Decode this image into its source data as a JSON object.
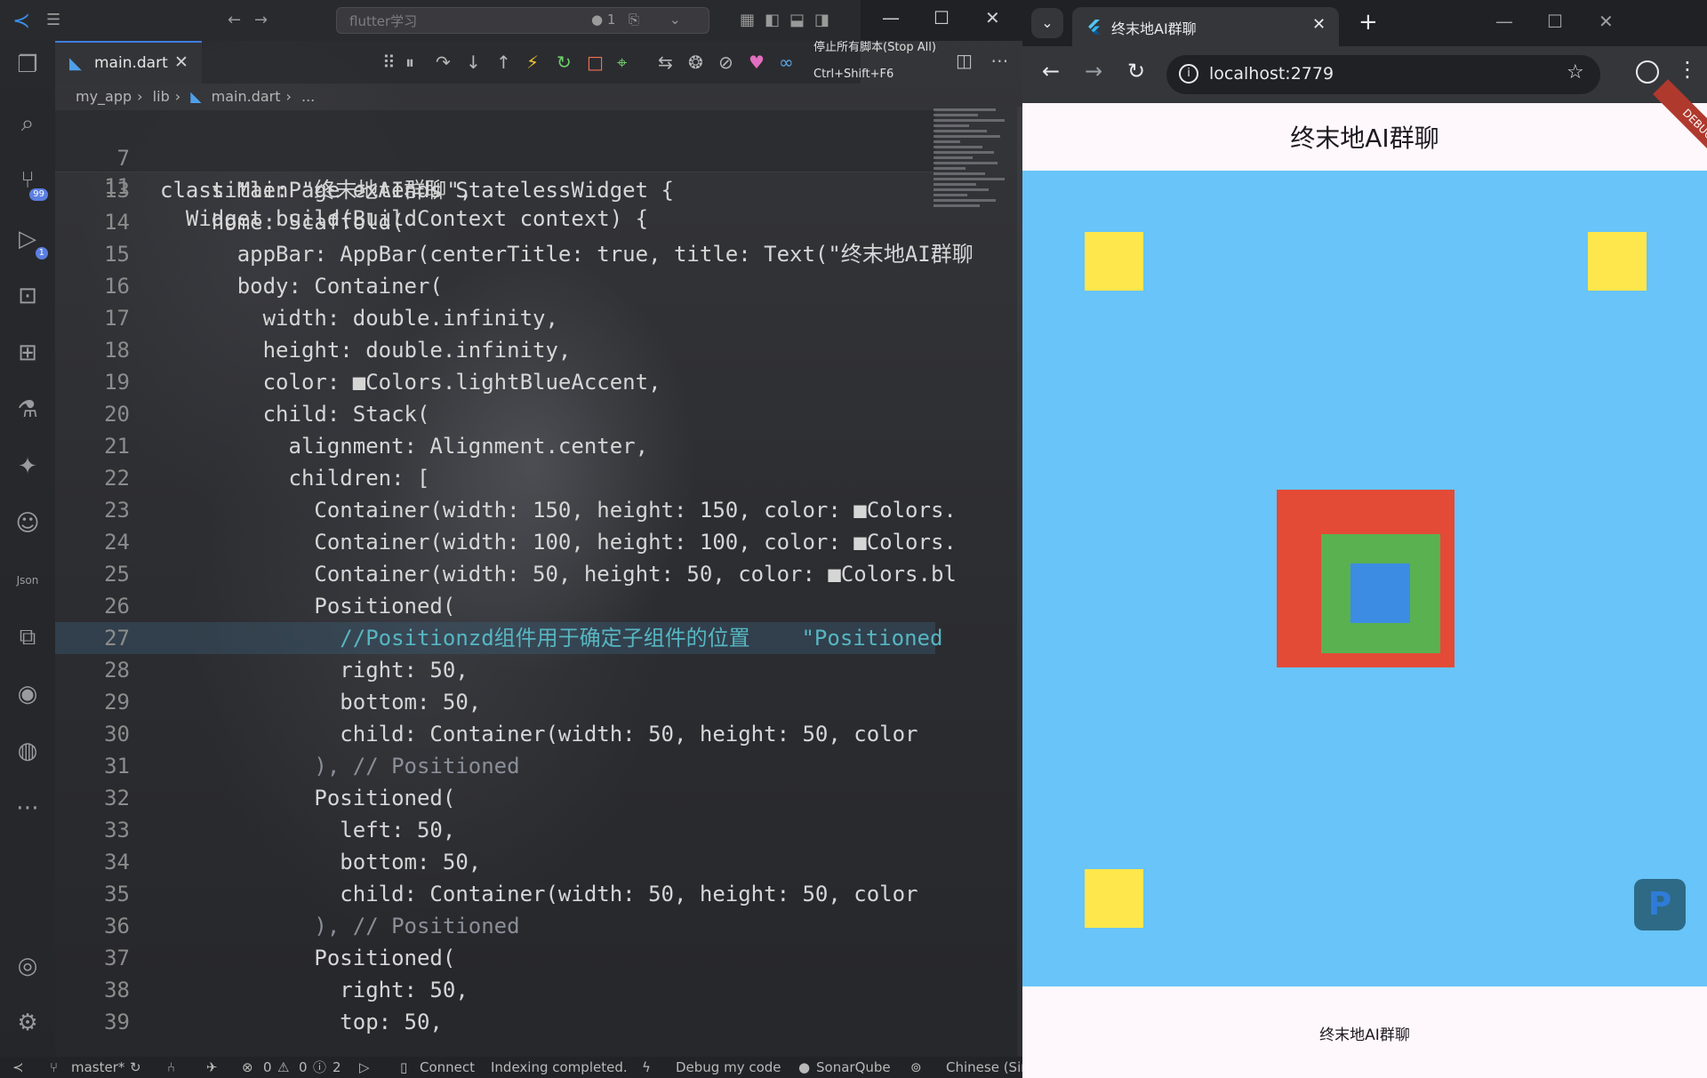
{
  "vscode": {
    "search_placeholder": "flutter学习",
    "tab": {
      "label": "main.dart"
    },
    "breadcrumb": [
      "my_app",
      "lib",
      "main.dart",
      "..."
    ],
    "stop_tooltip": {
      "label": "停止所有脚本(Stop All)",
      "shortcut": "Ctrl+Shift+F6"
    },
    "activity_badges": {
      "scm": "99",
      "debug": "1"
    },
    "activity_icons": [
      "explorer-icon",
      "search-icon",
      "source-control-icon",
      "run-debug-icon",
      "remote-explorer-icon",
      "extensions-icon",
      "testing-icon",
      "flutter-icon",
      "copilot-icon",
      "json-icon",
      "branch-graph-icon",
      "github-icon",
      "sync-icon",
      "more-icon",
      "account-icon",
      "settings-icon"
    ],
    "sticky_lines": [
      {
        "num": "7",
        "text": "class MainPage extends StatelessWidget {"
      },
      {
        "num": "11",
        "text": "  Widget build(BuildContext context) {"
      }
    ],
    "lines": [
      {
        "num": "13",
        "text": "    title: \"终末地AI群聊\","
      },
      {
        "num": "14",
        "text": "    home: Scaffold("
      },
      {
        "num": "15",
        "text": "      appBar: AppBar(centerTitle: true, title: Text(\"终末地AI群聊"
      },
      {
        "num": "16",
        "text": "      body: Container("
      },
      {
        "num": "17",
        "text": "        width: double.infinity,"
      },
      {
        "num": "18",
        "text": "        height: double.infinity,"
      },
      {
        "num": "19",
        "text": "        color: ■Colors.lightBlueAccent,"
      },
      {
        "num": "20",
        "text": "        child: Stack("
      },
      {
        "num": "21",
        "text": "          alignment: Alignment.center,"
      },
      {
        "num": "22",
        "text": "          children: ["
      },
      {
        "num": "23",
        "text": "            Container(width: 150, height: 150, color: ■Colors."
      },
      {
        "num": "24",
        "text": "            Container(width: 100, height: 100, color: ■Colors."
      },
      {
        "num": "25",
        "text": "            Container(width: 50, height: 50, color: ■Colors.bl"
      },
      {
        "num": "26",
        "text": "            Positioned("
      },
      {
        "num": "27",
        "text": "              //Positionzd组件用于确定子组件的位置    \"Positioned"
      },
      {
        "num": "28",
        "text": "              right: 50,"
      },
      {
        "num": "29",
        "text": "              bottom: 50,"
      },
      {
        "num": "30",
        "text": "              child: Container(width: 50, height: 50, color"
      },
      {
        "num": "31",
        "text": "            ), // Positioned"
      },
      {
        "num": "32",
        "text": "            Positioned("
      },
      {
        "num": "33",
        "text": "              left: 50,"
      },
      {
        "num": "34",
        "text": "              bottom: 50,"
      },
      {
        "num": "35",
        "text": "              child: Container(width: 50, height: 50, color"
      },
      {
        "num": "36",
        "text": "            ), // Positioned"
      },
      {
        "num": "37",
        "text": "            Positioned("
      },
      {
        "num": "38",
        "text": "              right: 50,"
      },
      {
        "num": "39",
        "text": "              top: 50,"
      }
    ],
    "swatches": {
      "lightBlueAccent": "#40c4ff",
      "red": "#f44336",
      "green": "#4caf50",
      "blue": "#64b5f6"
    },
    "status": {
      "branch": "master*",
      "problems": "0",
      "warnings": "0",
      "infos": "2",
      "connect": "Connect",
      "indexing": "Indexing completed.",
      "debug_code": "Debug my code",
      "sonar": "SonarQube",
      "language": "Chinese (Sin"
    }
  },
  "browser": {
    "tab_title": "终末地AI群聊",
    "url": "localhost:2779",
    "app_title": "终末地AI群聊",
    "bottom_text": "终末地AI群聊",
    "debug_banner": "DEBUG",
    "p_button": "P",
    "colors": {
      "background": "#68c4f9",
      "yellow": "#fde74c",
      "red": "#e34b36",
      "green": "#5ab14f",
      "blue": "#3d8ce4"
    }
  }
}
